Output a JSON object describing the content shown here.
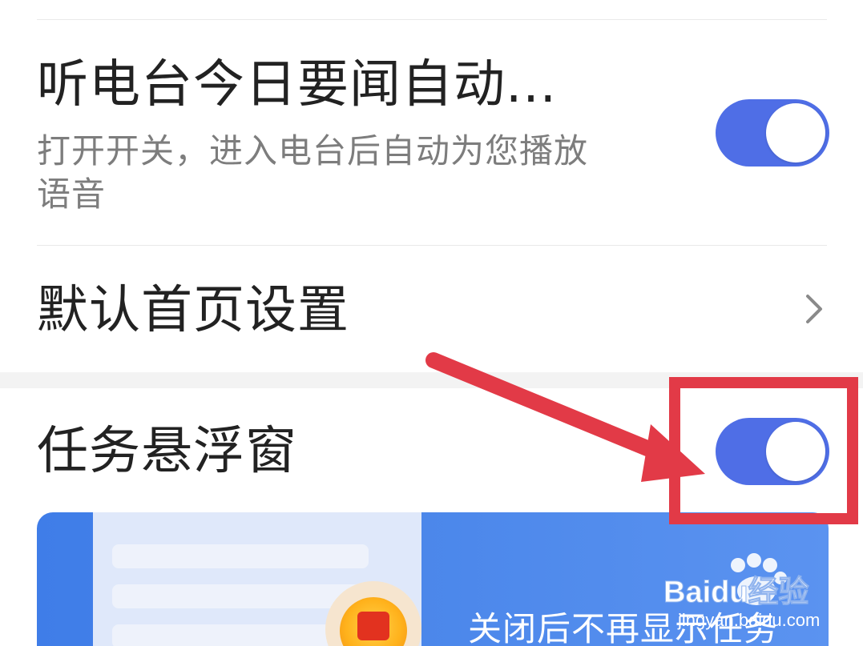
{
  "settings": {
    "radio_autoplay": {
      "title": "听电台今日要闻自动...",
      "description": "打开开关，进入电台后自动为您播放语音",
      "enabled": true
    },
    "default_homepage": {
      "title": "默认首页设置"
    },
    "task_float_window": {
      "title": "任务悬浮窗",
      "enabled": true
    }
  },
  "banner": {
    "text": "关闭后不再显示任务"
  },
  "watermark": {
    "brand": "Baidu经验",
    "url": "jingyan.baidu.com"
  },
  "colors": {
    "toggle_on": "#4f6ee6",
    "annotation_red": "#e23a47",
    "banner_blue": "#4a86ea"
  },
  "icons": {
    "chevron": "chevron-right-icon",
    "annotation_arrow": "red-arrow-annotation",
    "annotation_box": "red-highlight-box"
  }
}
